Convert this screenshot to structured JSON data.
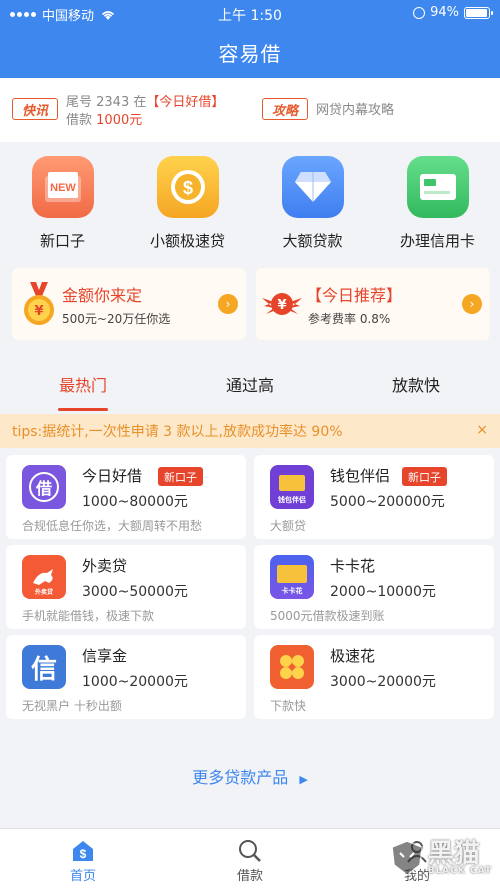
{
  "status": {
    "carrier": "中国移动",
    "time": "上午 1:50",
    "battery": "94%",
    "battery_level": 0.94
  },
  "header": {
    "title": "容易借"
  },
  "news": {
    "tag1": "快讯",
    "line1a": "尾号 2343 在",
    "line1b": "【今日好借】",
    "line2a": "借款",
    "line2b": "1000元",
    "tag2": "攻略",
    "line3": "网贷内幕攻略"
  },
  "quick": [
    {
      "label": "新口子",
      "icon": "new-folder-icon",
      "color": "#f47a55"
    },
    {
      "label": "小额极速贷",
      "icon": "coin-icon",
      "color": "#f7b32b"
    },
    {
      "label": "大额贷款",
      "icon": "diamond-icon",
      "color": "#4f8ff5"
    },
    {
      "label": "办理信用卡",
      "icon": "card-icon",
      "color": "#3ec46d"
    }
  ],
  "promos": [
    {
      "title": "金额你来定",
      "sub": "500元~20万任你选",
      "icon": "medal-icon"
    },
    {
      "title": "【今日推荐】",
      "sub": "参考费率 0.8%",
      "icon": "flying-coin-icon"
    }
  ],
  "tabs": [
    "最热门",
    "通过高",
    "放款快"
  ],
  "tips": {
    "text": "tips:据统计,一次性申请 3 款以上,放款成功率达 90%",
    "close": "×"
  },
  "products": [
    {
      "name": "今日好借",
      "badge": "新口子",
      "range": "1000~80000元",
      "desc": "合规低息任你选，大额周转不用愁",
      "logo_text": "借",
      "logo_color": "#7b57e0"
    },
    {
      "name": "钱包伴侣",
      "badge": "新口子",
      "range": "5000~200000元",
      "desc": "大额贷",
      "logo_text": "钱包伴侣",
      "logo_color": "#6f3fd6"
    },
    {
      "name": "外卖贷",
      "badge": "",
      "range": "3000~50000元",
      "desc": "手机就能借钱，极速下款",
      "logo_text": "外卖贷",
      "logo_color": "#f35a35"
    },
    {
      "name": "卡卡花",
      "badge": "",
      "range": "2000~10000元",
      "desc": "5000元借款极速到账",
      "logo_text": "卡卡花",
      "logo_color": "#5e6ef0"
    },
    {
      "name": "信享金",
      "badge": "",
      "range": "1000~20000元",
      "desc": "无视黑户  十秒出额",
      "logo_text": "信",
      "logo_color": "#3f7ad8"
    },
    {
      "name": "极速花",
      "badge": "",
      "range": "3000~20000元",
      "desc": "下款快",
      "logo_text": "",
      "logo_color": "#f06030"
    }
  ],
  "more": {
    "label": "更多贷款产品",
    "arrow": "▶"
  },
  "bottom_nav": [
    {
      "label": "首页",
      "icon": "home-dollar-icon"
    },
    {
      "label": "借款",
      "icon": "search-icon"
    },
    {
      "label": "我的",
      "icon": "user-icon"
    }
  ],
  "watermark": {
    "cn": "黑猫",
    "en": "BLACK CAT"
  }
}
